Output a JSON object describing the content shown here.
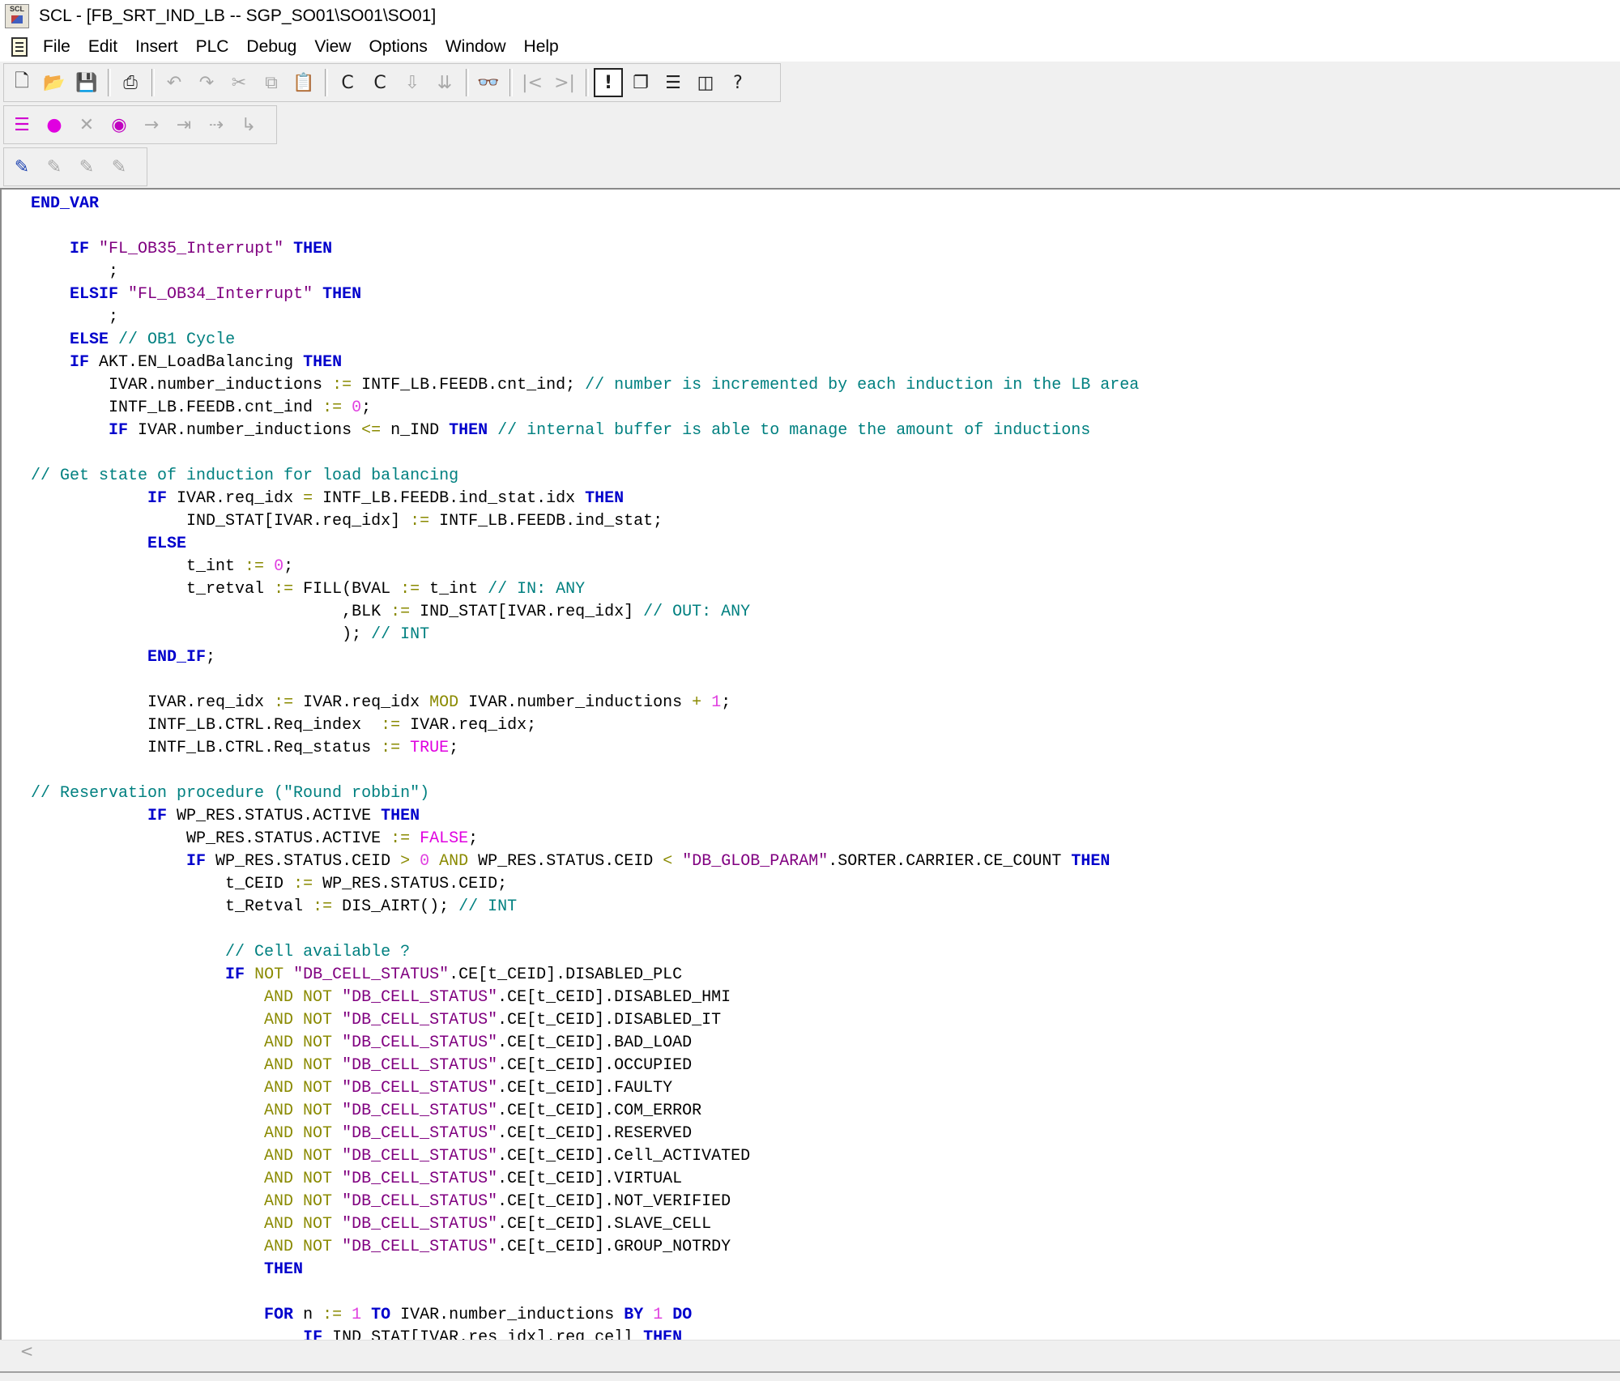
{
  "window": {
    "title": "SCL  - [FB_SRT_IND_LB -- SGP_SO01\\SO01\\SO01]",
    "app_icon_text": "SCL"
  },
  "menu": [
    "File",
    "Edit",
    "Insert",
    "PLC",
    "Debug",
    "View",
    "Options",
    "Window",
    "Help"
  ],
  "toolbar1": [
    {
      "icon": "new-icon",
      "glyph": "🗋",
      "enabled": true
    },
    {
      "icon": "open-icon",
      "glyph": "📂",
      "enabled": true
    },
    {
      "icon": "save-icon",
      "glyph": "💾",
      "enabled": true
    },
    {
      "icon": "print-icon",
      "glyph": "⎙",
      "enabled": true
    },
    {
      "icon": "undo-icon",
      "glyph": "↶",
      "enabled": false
    },
    {
      "icon": "redo-icon",
      "glyph": "↷",
      "enabled": false
    },
    {
      "icon": "cut-icon",
      "glyph": "✂",
      "enabled": false
    },
    {
      "icon": "copy-icon",
      "glyph": "⧉",
      "enabled": false
    },
    {
      "icon": "paste-icon",
      "glyph": "📋",
      "enabled": false
    },
    {
      "icon": "compile-icon",
      "glyph": "C",
      "enabled": true
    },
    {
      "icon": "compile-all-icon",
      "glyph": "C",
      "enabled": true
    },
    {
      "icon": "download-icon",
      "glyph": "⇩",
      "enabled": false
    },
    {
      "icon": "download-all-icon",
      "glyph": "⇊",
      "enabled": false
    },
    {
      "icon": "monitor-icon",
      "glyph": "👓",
      "enabled": true
    },
    {
      "icon": "previous-icon",
      "glyph": "|<",
      "enabled": false
    },
    {
      "icon": "next-icon",
      "glyph": ">|",
      "enabled": false
    },
    {
      "icon": "alert-icon",
      "glyph": "!",
      "enabled": true,
      "boxed": true
    },
    {
      "icon": "cascade-icon",
      "glyph": "❐",
      "enabled": true
    },
    {
      "icon": "tile-horizontal-icon",
      "glyph": "☰",
      "enabled": true
    },
    {
      "icon": "tile-vertical-icon",
      "glyph": "◫",
      "enabled": true
    },
    {
      "icon": "help-icon",
      "glyph": "?",
      "enabled": true
    }
  ],
  "toolbar2": [
    {
      "icon": "breakpoint-list-icon",
      "glyph": "☰",
      "enabled": true,
      "color": "#d000d0"
    },
    {
      "icon": "set-breakpoint-icon",
      "glyph": "●",
      "enabled": true,
      "color": "#e000e0"
    },
    {
      "icon": "delete-breakpoint-icon",
      "glyph": "✕",
      "enabled": false
    },
    {
      "icon": "activate-breakpoints-icon",
      "glyph": "◉",
      "enabled": true,
      "color": "#c000c0"
    },
    {
      "icon": "next-statement-icon",
      "glyph": "→",
      "enabled": false
    },
    {
      "icon": "continue-icon",
      "glyph": "⇥",
      "enabled": false
    },
    {
      "icon": "to-cursor-icon",
      "glyph": "⇢",
      "enabled": false
    },
    {
      "icon": "step-into-icon",
      "glyph": "↳",
      "enabled": false
    }
  ],
  "toolbar3": [
    {
      "icon": "template-icon",
      "glyph": "✎",
      "enabled": true,
      "color": "#1a40b0"
    },
    {
      "icon": "template-2-icon",
      "glyph": "✎",
      "enabled": false
    },
    {
      "icon": "template-3-icon",
      "glyph": "✎",
      "enabled": false
    },
    {
      "icon": "template-4-icon",
      "glyph": "✎",
      "enabled": false
    }
  ],
  "code_lines": [
    [
      [
        "kw",
        "END_VAR"
      ]
    ],
    [],
    [
      [
        "",
        "    "
      ],
      [
        "kw",
        "IF"
      ],
      [
        "",
        " "
      ],
      [
        "st",
        "\"FL_OB35_Interrupt\""
      ],
      [
        "",
        " "
      ],
      [
        "kw",
        "THEN"
      ]
    ],
    [
      [
        "",
        "        ;"
      ]
    ],
    [
      [
        "",
        "    "
      ],
      [
        "kw",
        "ELSIF"
      ],
      [
        "",
        " "
      ],
      [
        "st",
        "\"FL_OB34_Interrupt\""
      ],
      [
        "",
        " "
      ],
      [
        "kw",
        "THEN"
      ]
    ],
    [
      [
        "",
        "        ;"
      ]
    ],
    [
      [
        "",
        "    "
      ],
      [
        "kw",
        "ELSE"
      ],
      [
        "",
        " "
      ],
      [
        "cm",
        "// OB1 Cycle"
      ]
    ],
    [
      [
        "",
        "    "
      ],
      [
        "kw",
        "IF"
      ],
      [
        "",
        " AKT.EN_LoadBalancing "
      ],
      [
        "kw",
        "THEN"
      ]
    ],
    [
      [
        "",
        "        IVAR.number_inductions "
      ],
      [
        "op",
        ":="
      ],
      [
        "",
        " INTF_LB.FEEDB.cnt_ind; "
      ],
      [
        "cm",
        "// number is incremented by each induction in the LB area"
      ]
    ],
    [
      [
        "",
        "        INTF_LB.FEEDB.cnt_ind "
      ],
      [
        "op",
        ":="
      ],
      [
        "",
        " "
      ],
      [
        "num",
        "0"
      ],
      [
        "",
        ";"
      ]
    ],
    [
      [
        "",
        "        "
      ],
      [
        "kw",
        "IF"
      ],
      [
        "",
        " IVAR.number_inductions "
      ],
      [
        "op",
        "<="
      ],
      [
        "",
        " n_IND "
      ],
      [
        "kw",
        "THEN"
      ],
      [
        "",
        " "
      ],
      [
        "cm",
        "// internal buffer is able to manage the amount of inductions"
      ]
    ],
    [],
    [
      [
        "cm",
        "// Get state of induction for load balancing"
      ]
    ],
    [
      [
        "",
        "            "
      ],
      [
        "kw",
        "IF"
      ],
      [
        "",
        " IVAR.req_idx "
      ],
      [
        "op",
        "="
      ],
      [
        "",
        " INTF_LB.FEEDB.ind_stat.idx "
      ],
      [
        "kw",
        "THEN"
      ]
    ],
    [
      [
        "",
        "                IND_STAT[IVAR.req_idx] "
      ],
      [
        "op",
        ":="
      ],
      [
        "",
        " INTF_LB.FEEDB.ind_stat;"
      ]
    ],
    [
      [
        "",
        "            "
      ],
      [
        "kw",
        "ELSE"
      ]
    ],
    [
      [
        "",
        "                t_int "
      ],
      [
        "op",
        ":="
      ],
      [
        "",
        " "
      ],
      [
        "num",
        "0"
      ],
      [
        "",
        ";"
      ]
    ],
    [
      [
        "",
        "                t_retval "
      ],
      [
        "op",
        ":="
      ],
      [
        "",
        " FILL(BVAL "
      ],
      [
        "op",
        ":="
      ],
      [
        "",
        " t_int "
      ],
      [
        "cm",
        "// IN: ANY"
      ]
    ],
    [
      [
        "",
        "                                ,BLK "
      ],
      [
        "op",
        ":="
      ],
      [
        "",
        " IND_STAT[IVAR.req_idx] "
      ],
      [
        "cm",
        "// OUT: ANY"
      ]
    ],
    [
      [
        "",
        "                                ); "
      ],
      [
        "cm",
        "// INT"
      ]
    ],
    [
      [
        "",
        "            "
      ],
      [
        "kw",
        "END_IF"
      ],
      [
        "",
        ";"
      ]
    ],
    [],
    [
      [
        "",
        "            IVAR.req_idx "
      ],
      [
        "op",
        ":="
      ],
      [
        "",
        " IVAR.req_idx "
      ],
      [
        "op",
        "MOD"
      ],
      [
        "",
        " IVAR.number_inductions "
      ],
      [
        "op",
        "+"
      ],
      [
        "",
        " "
      ],
      [
        "num",
        "1"
      ],
      [
        "",
        ";"
      ]
    ],
    [
      [
        "",
        "            INTF_LB.CTRL.Req_index  "
      ],
      [
        "op",
        ":="
      ],
      [
        "",
        " IVAR.req_idx;"
      ]
    ],
    [
      [
        "",
        "            INTF_LB.CTRL.Req_status "
      ],
      [
        "op",
        ":="
      ],
      [
        "",
        " "
      ],
      [
        "bl",
        "TRUE"
      ],
      [
        "",
        ";"
      ]
    ],
    [],
    [
      [
        "cm",
        "// Reservation procedure (\"Round robbin\")"
      ]
    ],
    [
      [
        "",
        "            "
      ],
      [
        "kw",
        "IF"
      ],
      [
        "",
        " WP_RES.STATUS.ACTIVE "
      ],
      [
        "kw",
        "THEN"
      ]
    ],
    [
      [
        "",
        "                WP_RES.STATUS.ACTIVE "
      ],
      [
        "op",
        ":="
      ],
      [
        "",
        " "
      ],
      [
        "bl",
        "FALSE"
      ],
      [
        "",
        ";"
      ]
    ],
    [
      [
        "",
        "                "
      ],
      [
        "kw",
        "IF"
      ],
      [
        "",
        " WP_RES.STATUS.CEID "
      ],
      [
        "op",
        ">"
      ],
      [
        "",
        " "
      ],
      [
        "num",
        "0"
      ],
      [
        "",
        " "
      ],
      [
        "op",
        "AND"
      ],
      [
        "",
        " WP_RES.STATUS.CEID "
      ],
      [
        "op",
        "<"
      ],
      [
        "",
        " "
      ],
      [
        "st",
        "\"DB_GLOB_PARAM\""
      ],
      [
        "",
        ".SORTER.CARRIER.CE_COUNT "
      ],
      [
        "kw",
        "THEN"
      ]
    ],
    [
      [
        "",
        "                    t_CEID "
      ],
      [
        "op",
        ":="
      ],
      [
        "",
        " WP_RES.STATUS.CEID;"
      ]
    ],
    [
      [
        "",
        "                    t_Retval "
      ],
      [
        "op",
        ":="
      ],
      [
        "",
        " DIS_AIRT(); "
      ],
      [
        "cm",
        "// INT"
      ]
    ],
    [],
    [
      [
        "",
        "                    "
      ],
      [
        "cm",
        "// Cell available ?"
      ]
    ],
    [
      [
        "",
        "                    "
      ],
      [
        "kw",
        "IF"
      ],
      [
        "",
        " "
      ],
      [
        "op",
        "NOT"
      ],
      [
        "",
        " "
      ],
      [
        "st",
        "\"DB_CELL_STATUS\""
      ],
      [
        "",
        ".CE[t_CEID].DISABLED_PLC"
      ]
    ],
    [
      [
        "",
        "                        "
      ],
      [
        "op",
        "AND NOT"
      ],
      [
        "",
        " "
      ],
      [
        "st",
        "\"DB_CELL_STATUS\""
      ],
      [
        "",
        ".CE[t_CEID].DISABLED_HMI"
      ]
    ],
    [
      [
        "",
        "                        "
      ],
      [
        "op",
        "AND NOT"
      ],
      [
        "",
        " "
      ],
      [
        "st",
        "\"DB_CELL_STATUS\""
      ],
      [
        "",
        ".CE[t_CEID].DISABLED_IT"
      ]
    ],
    [
      [
        "",
        "                        "
      ],
      [
        "op",
        "AND NOT"
      ],
      [
        "",
        " "
      ],
      [
        "st",
        "\"DB_CELL_STATUS\""
      ],
      [
        "",
        ".CE[t_CEID].BAD_LOAD"
      ]
    ],
    [
      [
        "",
        "                        "
      ],
      [
        "op",
        "AND NOT"
      ],
      [
        "",
        " "
      ],
      [
        "st",
        "\"DB_CELL_STATUS\""
      ],
      [
        "",
        ".CE[t_CEID].OCCUPIED"
      ]
    ],
    [
      [
        "",
        "                        "
      ],
      [
        "op",
        "AND NOT"
      ],
      [
        "",
        " "
      ],
      [
        "st",
        "\"DB_CELL_STATUS\""
      ],
      [
        "",
        ".CE[t_CEID].FAULTY"
      ]
    ],
    [
      [
        "",
        "                        "
      ],
      [
        "op",
        "AND NOT"
      ],
      [
        "",
        " "
      ],
      [
        "st",
        "\"DB_CELL_STATUS\""
      ],
      [
        "",
        ".CE[t_CEID].COM_ERROR"
      ]
    ],
    [
      [
        "",
        "                        "
      ],
      [
        "op",
        "AND NOT"
      ],
      [
        "",
        " "
      ],
      [
        "st",
        "\"DB_CELL_STATUS\""
      ],
      [
        "",
        ".CE[t_CEID].RESERVED"
      ]
    ],
    [
      [
        "",
        "                        "
      ],
      [
        "op",
        "AND NOT"
      ],
      [
        "",
        " "
      ],
      [
        "st",
        "\"DB_CELL_STATUS\""
      ],
      [
        "",
        ".CE[t_CEID].Cell_ACTIVATED"
      ]
    ],
    [
      [
        "",
        "                        "
      ],
      [
        "op",
        "AND NOT"
      ],
      [
        "",
        " "
      ],
      [
        "st",
        "\"DB_CELL_STATUS\""
      ],
      [
        "",
        ".CE[t_CEID].VIRTUAL"
      ]
    ],
    [
      [
        "",
        "                        "
      ],
      [
        "op",
        "AND NOT"
      ],
      [
        "",
        " "
      ],
      [
        "st",
        "\"DB_CELL_STATUS\""
      ],
      [
        "",
        ".CE[t_CEID].NOT_VERIFIED"
      ]
    ],
    [
      [
        "",
        "                        "
      ],
      [
        "op",
        "AND NOT"
      ],
      [
        "",
        " "
      ],
      [
        "st",
        "\"DB_CELL_STATUS\""
      ],
      [
        "",
        ".CE[t_CEID].SLAVE_CELL"
      ]
    ],
    [
      [
        "",
        "                        "
      ],
      [
        "op",
        "AND NOT"
      ],
      [
        "",
        " "
      ],
      [
        "st",
        "\"DB_CELL_STATUS\""
      ],
      [
        "",
        ".CE[t_CEID].GROUP_NOTRDY"
      ]
    ],
    [
      [
        "",
        "                        "
      ],
      [
        "kw",
        "THEN"
      ]
    ],
    [],
    [
      [
        "",
        "                        "
      ],
      [
        "kw",
        "FOR"
      ],
      [
        "",
        " n "
      ],
      [
        "op",
        ":="
      ],
      [
        "",
        " "
      ],
      [
        "num",
        "1"
      ],
      [
        "",
        " "
      ],
      [
        "kw",
        "TO"
      ],
      [
        "",
        " IVAR.number_inductions "
      ],
      [
        "kw",
        "BY"
      ],
      [
        "",
        " "
      ],
      [
        "num",
        "1"
      ],
      [
        "",
        " "
      ],
      [
        "kw",
        "DO"
      ]
    ],
    [
      [
        "",
        "                            "
      ],
      [
        "kw",
        "IF"
      ],
      [
        "",
        " IND_STAT[IVAR.res_idx].req_cell "
      ],
      [
        "kw",
        "THEN"
      ]
    ]
  ],
  "scrollbar": {
    "left_arrow": "<"
  }
}
